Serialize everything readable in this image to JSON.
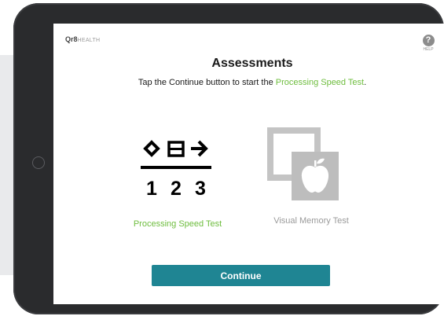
{
  "app": {
    "brand": "Qr8",
    "brand_sub": "HEALTH"
  },
  "header": {
    "help_glyph": "?",
    "help_label": "HELP"
  },
  "main": {
    "title": "Assessments",
    "subtitle_pre": "Tap the Continue button to start the ",
    "subtitle_highlight": "Processing Speed Test",
    "subtitle_post": "."
  },
  "tests": [
    {
      "label": "Processing Speed Test",
      "icon": "symbol-digit-icon",
      "active": true,
      "digits": [
        "1",
        "2",
        "3"
      ]
    },
    {
      "label": "Visual Memory Test",
      "icon": "apple-cards-icon",
      "active": false
    }
  ],
  "actions": {
    "continue_label": "Continue"
  },
  "colors": {
    "accent_green": "#6ebd3e",
    "button_teal": "#1f8593",
    "inactive_gray": "#9a9a9a",
    "device_frame": "#2a2b2d"
  }
}
